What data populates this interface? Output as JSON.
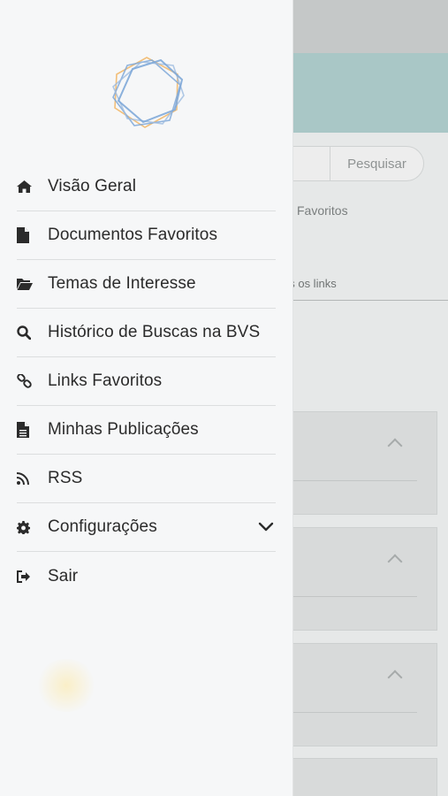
{
  "background": {
    "search_button_label": "Pesquisar",
    "favorites_label": "Favoritos",
    "tab_label": "os os links"
  },
  "drawer": {
    "menu": [
      {
        "label": "Visão Geral",
        "icon": "home-icon"
      },
      {
        "label": "Documentos Favoritos",
        "icon": "document-icon"
      },
      {
        "label": "Temas de Interesse",
        "icon": "folder-open-icon"
      },
      {
        "label": "Histórico de Buscas na BVS",
        "icon": "search-icon"
      },
      {
        "label": "Links Favoritos",
        "icon": "link-icon"
      },
      {
        "label": "Minhas Publicações",
        "icon": "document-text-icon"
      },
      {
        "label": "RSS",
        "icon": "rss-icon"
      },
      {
        "label": "Configurações",
        "icon": "gear-icon",
        "expandable": true
      },
      {
        "label": "Sair",
        "icon": "sign-out-icon"
      }
    ]
  },
  "colors": {
    "logo_blue": "#7fa8d8",
    "logo_orange": "#f2b86a",
    "menu_text": "#2b2b2b",
    "drawer_bg": "#f6f7f8"
  }
}
